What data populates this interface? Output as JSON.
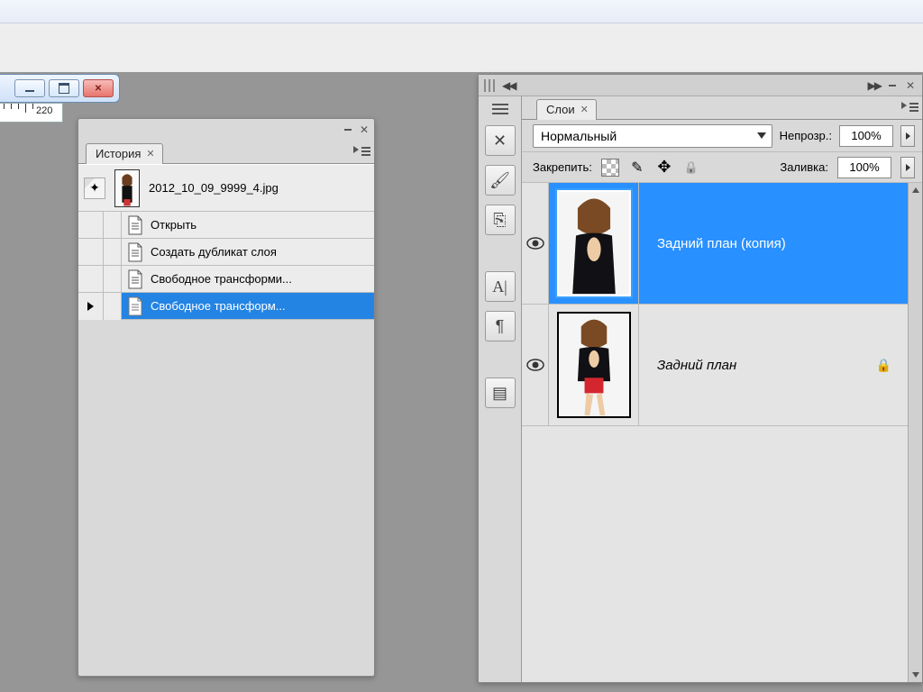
{
  "ruler": {
    "mark": "220"
  },
  "history_panel": {
    "tab": "История",
    "filename": "2012_10_09_9999_4.jpg",
    "items": [
      {
        "label": "Открыть"
      },
      {
        "label": "Создать дубликат слоя"
      },
      {
        "label": "Свободное трансформи..."
      },
      {
        "label": "Свободное трансформ..."
      }
    ]
  },
  "layers_panel": {
    "tab": "Слои",
    "blend_mode": "Нормальный",
    "opacity_label": "Непрозр.:",
    "opacity_value": "100%",
    "lock_label": "Закрепить:",
    "fill_label": "Заливка:",
    "fill_value": "100%",
    "layers": [
      {
        "name": "Задний план (копия)",
        "selected": true,
        "visible": true,
        "locked": false
      },
      {
        "name": "Задний план",
        "selected": false,
        "visible": true,
        "locked": true,
        "italic": true
      }
    ]
  }
}
